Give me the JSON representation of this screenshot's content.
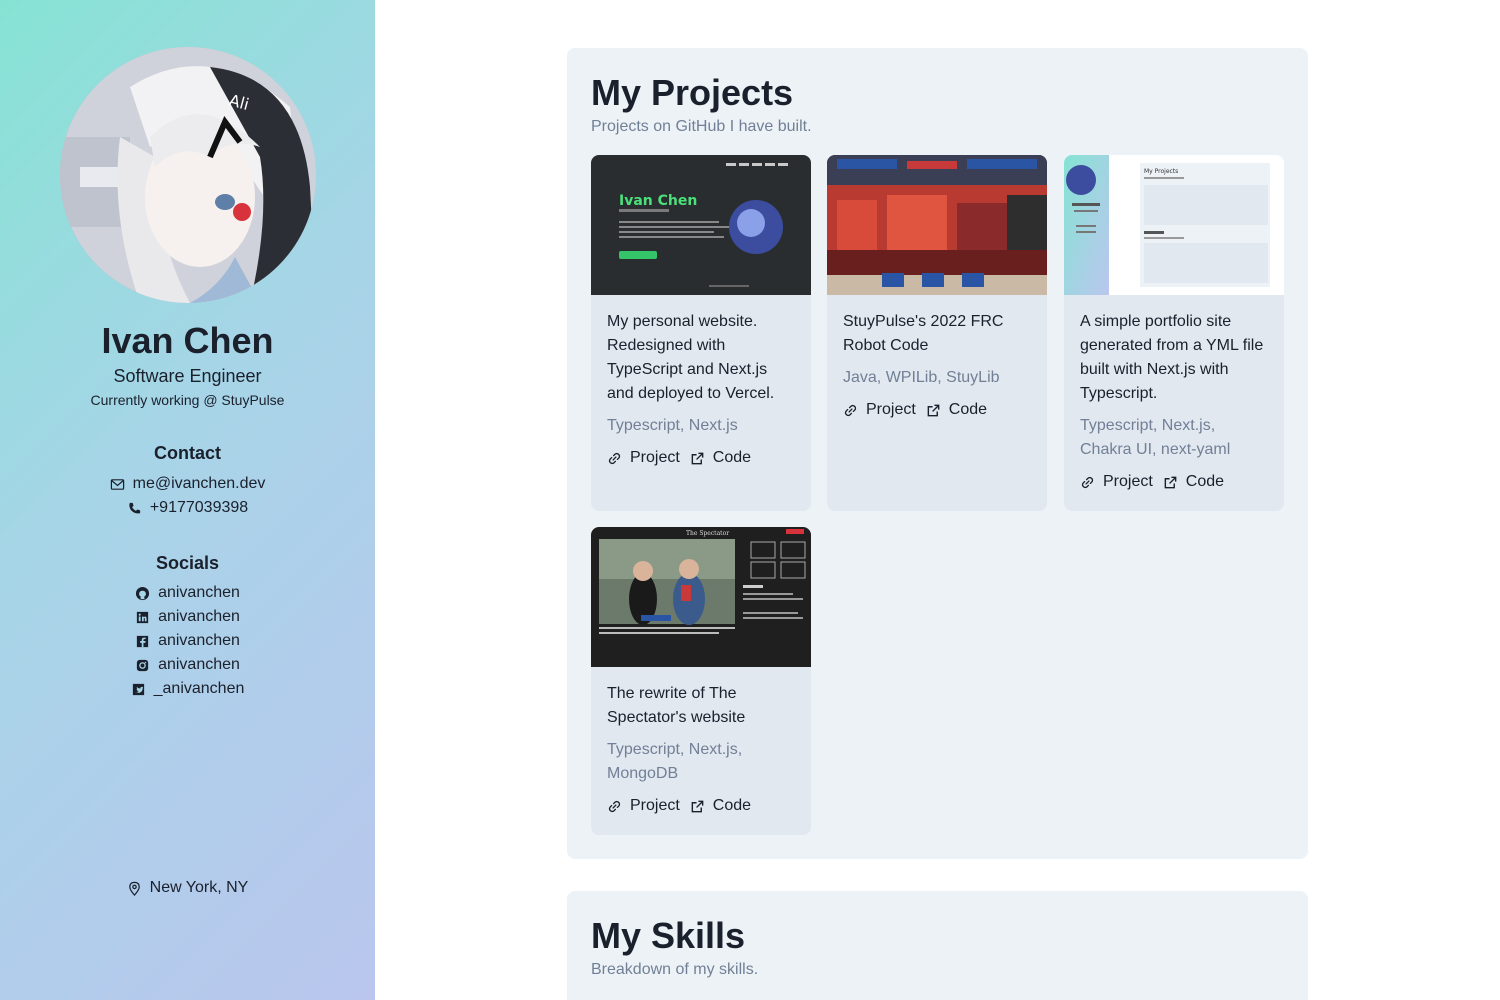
{
  "profile": {
    "name": "Ivan Chen",
    "role": "Software Engineer",
    "working": "Currently working @ StuyPulse"
  },
  "contact": {
    "heading": "Contact",
    "email": "me@ivanchen.dev",
    "phone": "+9177039398"
  },
  "socials": {
    "heading": "Socials",
    "items": [
      {
        "icon": "github-icon",
        "label": "anivanchen"
      },
      {
        "icon": "linkedin-icon",
        "label": "anivanchen"
      },
      {
        "icon": "facebook-icon",
        "label": "anivanchen"
      },
      {
        "icon": "instagram-icon",
        "label": "anivanchen"
      },
      {
        "icon": "twitter-icon",
        "label": "_anivanchen"
      }
    ]
  },
  "location": "New York, NY",
  "projects": {
    "title": "My Projects",
    "subtitle": "Projects on GitHub I have built.",
    "link_project": "Project",
    "link_code": "Code",
    "cards": [
      {
        "description": "My personal website. Redesigned with TypeScript and Next.js and deployed to Vercel.",
        "tech": "Typescript, Next.js",
        "thumb_text": "Ivan Chen"
      },
      {
        "description": "StuyPulse's 2022 FRC Robot Code",
        "tech": "Java, WPILib, StuyLib"
      },
      {
        "description": "A simple portfolio site generated from a YML file built with Next.js with Typescript.",
        "tech": "Typescript, Next.js, Chakra UI, next-yaml",
        "thumb_text": "My Projects"
      },
      {
        "description": "The rewrite of The Spectator's website",
        "tech": "Typescript, Next.js, MongoDB",
        "thumb_text": "The Spectator"
      }
    ]
  },
  "skills": {
    "title": "My Skills",
    "subtitle": "Breakdown of my skills."
  },
  "colors": {
    "sidebar_gradient_start": "#86e3d4",
    "sidebar_gradient_end": "#bac6ee",
    "panel_bg": "#edf2f7",
    "card_bg": "#e2e8f0",
    "muted_text": "#718096"
  }
}
